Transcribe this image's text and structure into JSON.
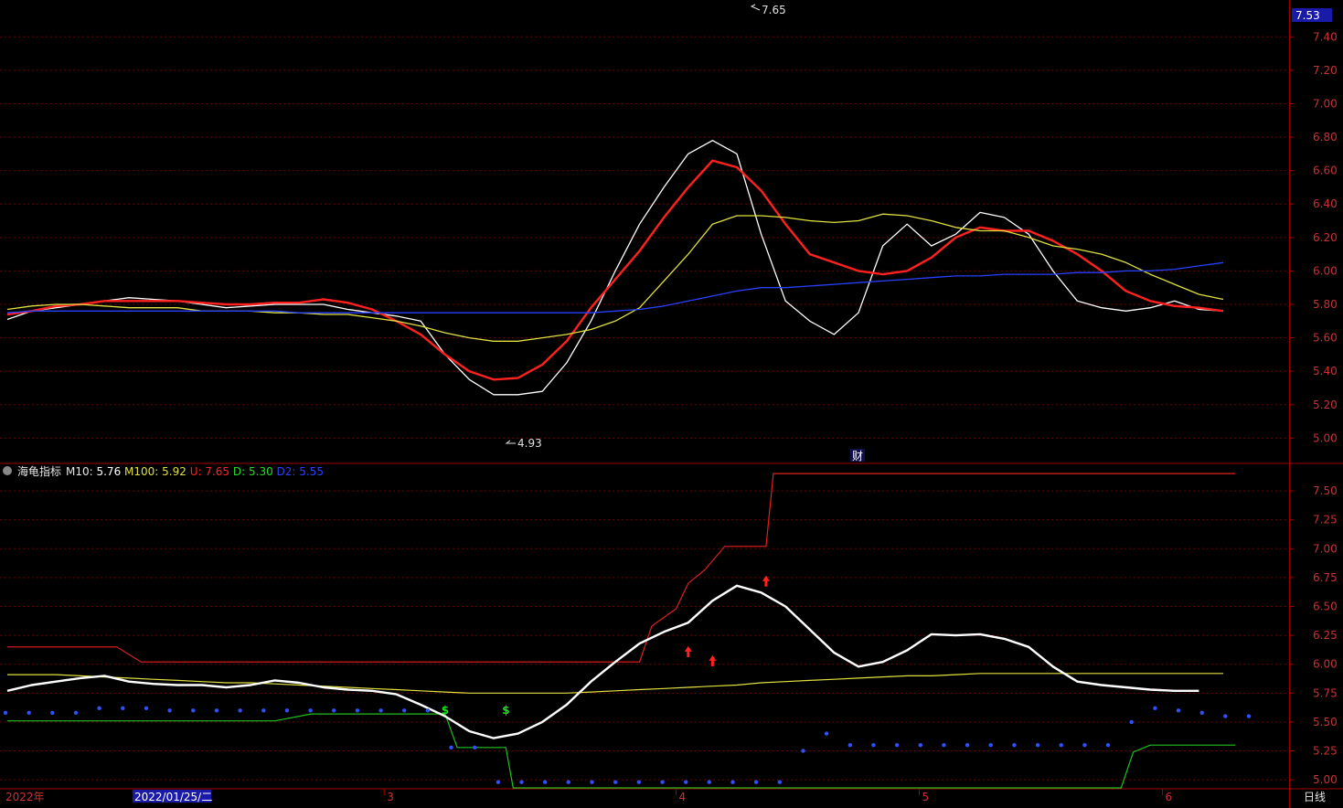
{
  "chart_data": {
    "type": "line",
    "main": {
      "ylim": [
        4.86,
        7.62
      ],
      "yticks": [
        "5.00",
        "5.20",
        "5.40",
        "5.60",
        "5.80",
        "6.00",
        "6.20",
        "6.40",
        "6.60",
        "6.80",
        "7.00",
        "7.20",
        "7.40"
      ],
      "current_price_label": "7.53",
      "high_label": "7.65",
      "low_label": "4.93",
      "event_marker": "财",
      "series": [
        {
          "color": "#ffffff",
          "values": [
            5.71,
            5.76,
            5.78,
            5.8,
            5.82,
            5.84,
            5.83,
            5.82,
            5.8,
            5.78,
            5.79,
            5.8,
            5.8,
            5.8,
            5.77,
            5.75,
            5.73,
            5.7,
            5.5,
            5.35,
            5.26,
            5.26,
            5.28,
            5.45,
            5.7,
            6.0,
            6.28,
            6.5,
            6.7,
            6.78,
            6.7,
            6.22,
            5.82,
            5.7,
            5.62,
            5.75,
            6.15,
            6.28,
            6.15,
            6.22,
            6.35,
            6.32,
            6.22,
            6.0,
            5.82,
            5.78,
            5.76,
            5.78,
            5.82,
            5.77,
            5.76
          ]
        },
        {
          "color": "#ff2020",
          "values": [
            5.74,
            5.76,
            5.79,
            5.8,
            5.82,
            5.82,
            5.82,
            5.82,
            5.81,
            5.8,
            5.8,
            5.81,
            5.81,
            5.83,
            5.81,
            5.77,
            5.7,
            5.62,
            5.5,
            5.4,
            5.35,
            5.36,
            5.44,
            5.58,
            5.78,
            5.95,
            6.12,
            6.32,
            6.5,
            6.66,
            6.62,
            6.48,
            6.28,
            6.1,
            6.05,
            6.0,
            5.98,
            6.0,
            6.08,
            6.2,
            6.26,
            6.24,
            6.24,
            6.18,
            6.1,
            6.0,
            5.88,
            5.82,
            5.79,
            5.78,
            5.76
          ]
        },
        {
          "color": "#e0e040",
          "values": [
            5.77,
            5.79,
            5.8,
            5.8,
            5.79,
            5.78,
            5.78,
            5.78,
            5.76,
            5.76,
            5.76,
            5.75,
            5.75,
            5.74,
            5.74,
            5.72,
            5.7,
            5.67,
            5.63,
            5.6,
            5.58,
            5.58,
            5.6,
            5.62,
            5.65,
            5.7,
            5.78,
            5.94,
            6.1,
            6.28,
            6.33,
            6.33,
            6.32,
            6.3,
            6.29,
            6.3,
            6.34,
            6.33,
            6.3,
            6.26,
            6.24,
            6.24,
            6.2,
            6.15,
            6.13,
            6.1,
            6.05,
            5.98,
            5.92,
            5.86,
            5.83
          ]
        },
        {
          "color": "#2840ff",
          "values": [
            5.75,
            5.76,
            5.76,
            5.76,
            5.76,
            5.76,
            5.76,
            5.76,
            5.76,
            5.76,
            5.76,
            5.76,
            5.75,
            5.75,
            5.75,
            5.75,
            5.75,
            5.75,
            5.75,
            5.75,
            5.75,
            5.75,
            5.75,
            5.75,
            5.75,
            5.76,
            5.77,
            5.79,
            5.82,
            5.85,
            5.88,
            5.9,
            5.9,
            5.91,
            5.92,
            5.93,
            5.94,
            5.95,
            5.96,
            5.97,
            5.97,
            5.98,
            5.98,
            5.98,
            5.99,
            5.99,
            6.0,
            6.0,
            6.01,
            6.03,
            6.05
          ]
        }
      ]
    },
    "indicator": {
      "name": "海龟指标",
      "legend": [
        {
          "label": "M10:",
          "value": "5.76",
          "color": "#ffffff"
        },
        {
          "label": "M100:",
          "value": "5.92",
          "color": "#e0e040"
        },
        {
          "label": "U:",
          "value": "7.65",
          "color": "#ff2020"
        },
        {
          "label": "D:",
          "value": "5.30",
          "color": "#20e020"
        },
        {
          "label": "D2:",
          "value": "5.55",
          "color": "#2840ff"
        }
      ],
      "ylim": [
        4.93,
        7.73
      ],
      "yticks": [
        "5.00",
        "5.25",
        "5.50",
        "5.75",
        "6.00",
        "6.25",
        "6.50",
        "6.75",
        "7.00",
        "7.25",
        "7.50"
      ],
      "U_steps": [
        [
          0,
          6.15
        ],
        [
          4.5,
          6.15
        ],
        [
          5.5,
          6.02
        ],
        [
          26,
          6.02
        ],
        [
          26.5,
          6.33
        ],
        [
          27.5,
          6.48
        ],
        [
          28,
          6.7
        ],
        [
          28.7,
          6.82
        ],
        [
          29.5,
          7.02
        ],
        [
          31.2,
          7.02
        ],
        [
          31.5,
          7.65
        ],
        [
          50.5,
          7.65
        ]
      ],
      "D_steps": [
        [
          0,
          5.51
        ],
        [
          11,
          5.51
        ],
        [
          12.5,
          5.57
        ],
        [
          18,
          5.57
        ],
        [
          18.5,
          5.28
        ],
        [
          20.5,
          5.28
        ],
        [
          20.8,
          4.93
        ],
        [
          45.8,
          4.93
        ],
        [
          46.3,
          5.24
        ],
        [
          47,
          5.3
        ],
        [
          50.5,
          5.3
        ]
      ],
      "D2_dots": [
        [
          0,
          5.58
        ],
        [
          1,
          5.58
        ],
        [
          2,
          5.58
        ],
        [
          3,
          5.58
        ],
        [
          4,
          5.62
        ],
        [
          5,
          5.62
        ],
        [
          6,
          5.62
        ],
        [
          7,
          5.6
        ],
        [
          8,
          5.6
        ],
        [
          9,
          5.6
        ],
        [
          10,
          5.6
        ],
        [
          11,
          5.6
        ],
        [
          12,
          5.6
        ],
        [
          13,
          5.6
        ],
        [
          14,
          5.6
        ],
        [
          15,
          5.6
        ],
        [
          16,
          5.6
        ],
        [
          17,
          5.6
        ],
        [
          18,
          5.6
        ],
        [
          19,
          5.28
        ],
        [
          20,
          5.28
        ],
        [
          21,
          4.98
        ],
        [
          22,
          4.98
        ],
        [
          23,
          4.98
        ],
        [
          24,
          4.98
        ],
        [
          25,
          4.98
        ],
        [
          26,
          4.98
        ],
        [
          27,
          4.98
        ],
        [
          28,
          4.98
        ],
        [
          29,
          4.98
        ],
        [
          30,
          4.98
        ],
        [
          31,
          4.98
        ],
        [
          32,
          4.98
        ],
        [
          33,
          4.98
        ],
        [
          34,
          5.25
        ],
        [
          35,
          5.4
        ],
        [
          36,
          5.3
        ],
        [
          37,
          5.3
        ],
        [
          38,
          5.3
        ],
        [
          39,
          5.3
        ],
        [
          40,
          5.3
        ],
        [
          41,
          5.3
        ],
        [
          42,
          5.3
        ],
        [
          43,
          5.3
        ],
        [
          44,
          5.3
        ],
        [
          45,
          5.3
        ],
        [
          46,
          5.3
        ],
        [
          47,
          5.3
        ],
        [
          48,
          5.5
        ],
        [
          49,
          5.62
        ],
        [
          50,
          5.6
        ],
        [
          51,
          5.58
        ],
        [
          52,
          5.55
        ],
        [
          53,
          5.55
        ]
      ],
      "M10": [
        5.77,
        5.82,
        5.85,
        5.88,
        5.9,
        5.85,
        5.83,
        5.82,
        5.82,
        5.8,
        5.82,
        5.86,
        5.84,
        5.8,
        5.78,
        5.77,
        5.74,
        5.65,
        5.55,
        5.42,
        5.36,
        5.4,
        5.5,
        5.65,
        5.85,
        6.02,
        6.18,
        6.28,
        6.36,
        6.55,
        6.68,
        6.62,
        6.5,
        6.3,
        6.1,
        5.98,
        6.02,
        6.12,
        6.26,
        6.25,
        6.26,
        6.22,
        6.15,
        5.98,
        5.85,
        5.82,
        5.8,
        5.78,
        5.77,
        5.77
      ],
      "M100": [
        5.91,
        5.91,
        5.91,
        5.9,
        5.89,
        5.88,
        5.87,
        5.86,
        5.85,
        5.84,
        5.84,
        5.83,
        5.82,
        5.81,
        5.8,
        5.79,
        5.78,
        5.77,
        5.76,
        5.75,
        5.75,
        5.75,
        5.75,
        5.75,
        5.76,
        5.77,
        5.78,
        5.79,
        5.8,
        5.81,
        5.82,
        5.84,
        5.85,
        5.86,
        5.87,
        5.88,
        5.89,
        5.9,
        5.9,
        5.91,
        5.92,
        5.92,
        5.92,
        5.92,
        5.92,
        5.92,
        5.92,
        5.92,
        5.92,
        5.92,
        5.92
      ],
      "buy_marks": [
        18,
        20.5
      ],
      "up_arrows": [
        [
          28,
          6.11
        ],
        [
          29,
          6.03
        ],
        [
          31.2,
          6.72
        ]
      ]
    },
    "bottom": {
      "year_label": "2022年",
      "date_label": "2022/01/25/二",
      "month_labels": [
        [
          "3",
          15.5
        ],
        [
          "4",
          27.5
        ],
        [
          "5",
          37.5
        ],
        [
          "6",
          47.5
        ]
      ],
      "period_label": "日线"
    }
  }
}
